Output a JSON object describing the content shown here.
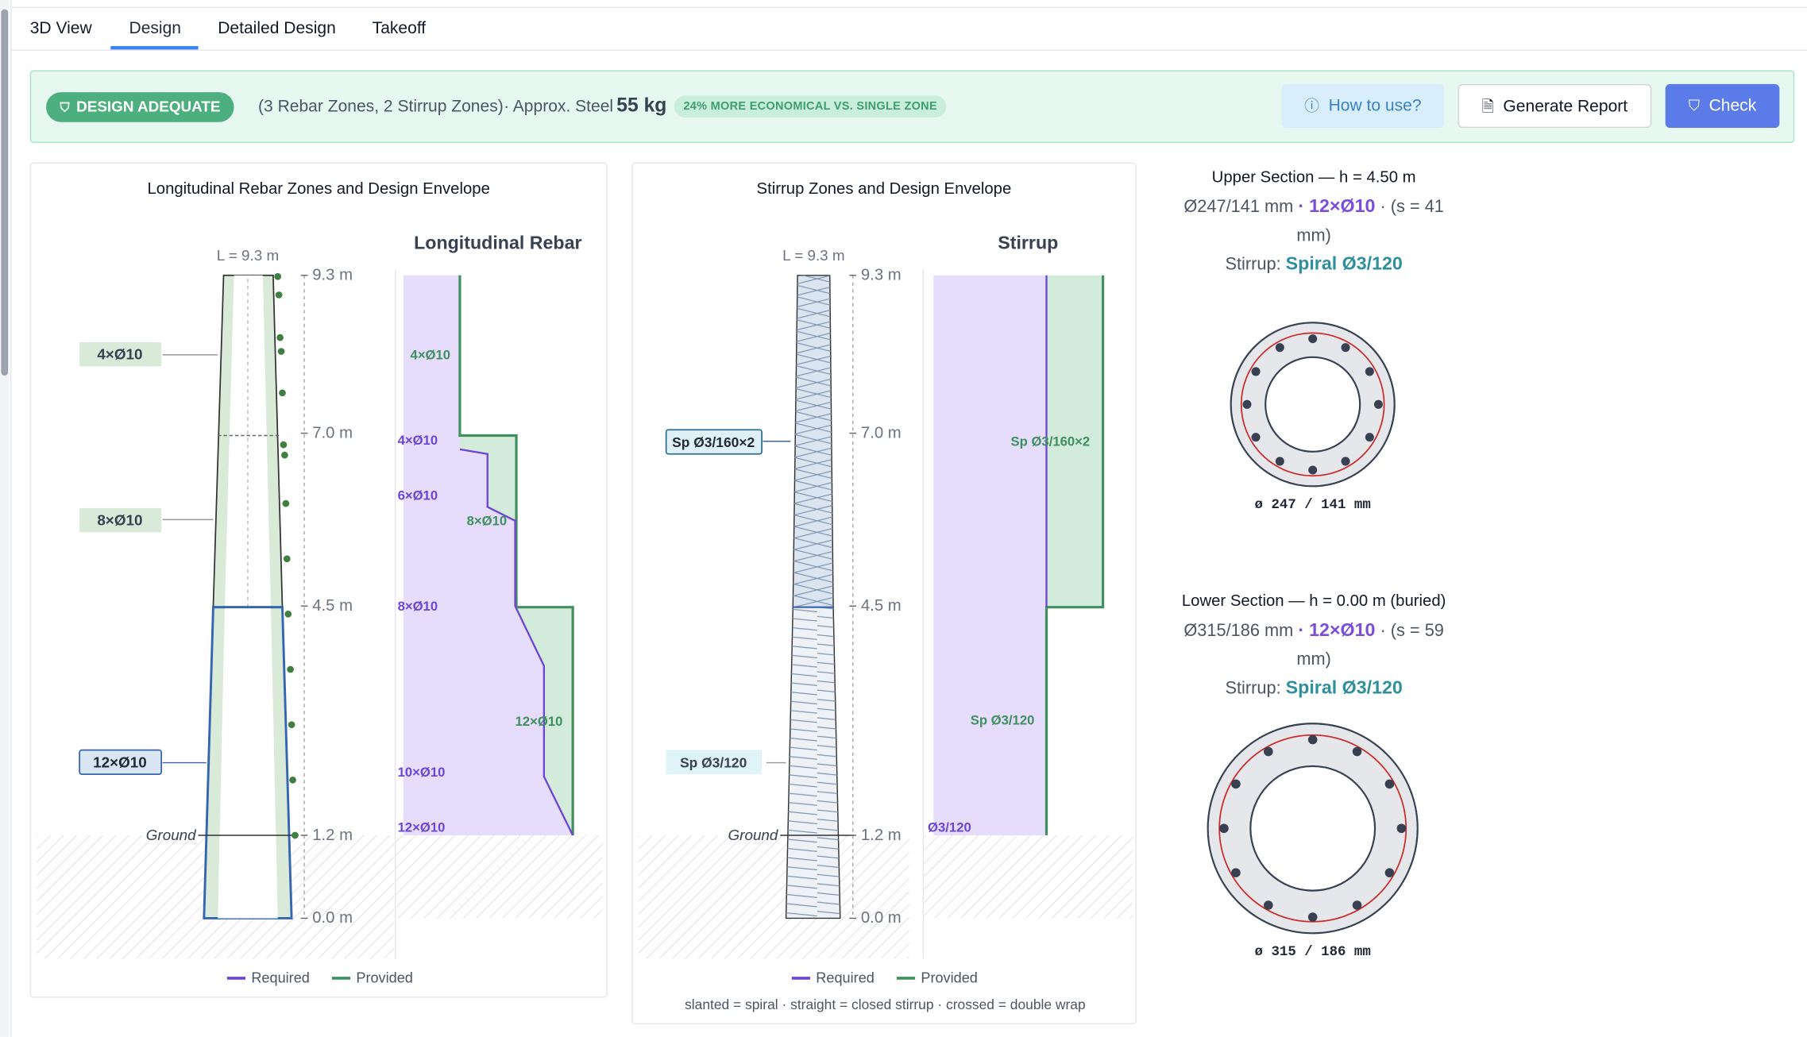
{
  "tabs": [
    {
      "label": "3D View",
      "active": false
    },
    {
      "label": "Design",
      "active": true
    },
    {
      "label": "Detailed Design",
      "active": false
    },
    {
      "label": "Takeoff",
      "active": false
    }
  ],
  "banner": {
    "status": "DESIGN ADEQUATE",
    "summary": "(3 Rebar Zones, 2 Stirrup Zones)",
    "steel_label": "· Approx. Steel",
    "steel_value": "55 kg",
    "economy": "24% MORE ECONOMICAL VS. SINGLE ZONE",
    "how_label": "How to use?",
    "report_label": "Generate Report",
    "check_label": "Check"
  },
  "colors": {
    "required": "#6d44d6",
    "provided": "#3f8f5f",
    "required_fill": "#e6dcfb",
    "provided_fill": "#d2ebda",
    "accent": "#5b7be8",
    "success": "#4caf7d"
  },
  "rebar_panel": {
    "title": "Longitudinal Rebar Zones and Design Envelope",
    "chart_title": "Longitudinal Rebar",
    "length_label": "L = 9.3 m",
    "ground_label": "Ground",
    "elevations": [
      "9.3 m",
      "7.0 m",
      "4.5 m",
      "1.2 m",
      "0.0 m"
    ],
    "zone_labels": [
      "4×Ø10",
      "8×Ø10",
      "12×Ø10"
    ],
    "required_labels": [
      "4×Ø10",
      "6×Ø10",
      "8×Ø10",
      "10×Ø10",
      "12×Ø10"
    ],
    "provided_labels": [
      "4×Ø10",
      "8×Ø10",
      "12×Ø10"
    ],
    "legend_required": "Required",
    "legend_provided": "Provided"
  },
  "stirrup_panel": {
    "title": "Stirrup Zones and Design Envelope",
    "chart_title": "Stirrup",
    "length_label": "L = 9.3 m",
    "ground_label": "Ground",
    "elevations": [
      "9.3 m",
      "7.0 m",
      "4.5 m",
      "1.2 m",
      "0.0 m"
    ],
    "zone_labels": [
      "Sp Ø3/160×2",
      "Sp Ø3/120"
    ],
    "provided_labels": [
      "Sp Ø3/160×2",
      "Sp Ø3/120"
    ],
    "required_label": "Ø3/120",
    "legend_required": "Required",
    "legend_provided": "Provided",
    "footnote": "slanted = spiral · straight = closed stirrup · crossed = double wrap"
  },
  "upper_section": {
    "title": "Upper Section — h = 4.50 m",
    "dims": "Ø247/141 mm",
    "rebar": "12×Ø10",
    "spacing": "· (s = 41",
    "spacing_unit": "mm)",
    "stirrup_label": "Stirrup:",
    "stirrup": "Spiral Ø3/120",
    "caption": "ø 247 / 141 mm",
    "bars": 12
  },
  "lower_section": {
    "title": "Lower Section — h = 0.00 m (buried)",
    "dims": "Ø315/186 mm",
    "rebar": "12×Ø10",
    "spacing": "· (s = 59",
    "spacing_unit": "mm)",
    "stirrup_label": "Stirrup:",
    "stirrup": "Spiral Ø3/120",
    "caption": "ø 315 / 186 mm",
    "bars": 12
  }
}
